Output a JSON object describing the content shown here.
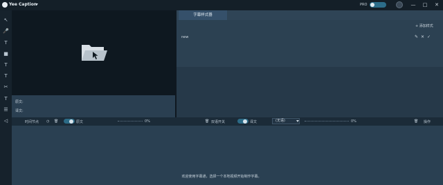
{
  "titlebar": {
    "app_title": "Yee Caption",
    "pro_label": "PRO",
    "minimize": "—",
    "maximize": "□",
    "close": "✕"
  },
  "tools": [
    "↖",
    "🎤",
    "T",
    "■",
    "T",
    "T",
    "✂",
    "T",
    "☰",
    "◁"
  ],
  "subtitles": {
    "line1_label": "原文:",
    "line2_label": "译文:"
  },
  "right_panel": {
    "tab_label": "字幕样式器",
    "add_style": "+ 添加样式",
    "style_name": "new",
    "edit_icon": "✎",
    "delete_icon": "✕",
    "confirm_icon": "✓"
  },
  "controls": {
    "timing_label": "时间节点",
    "source_label": "原文",
    "source_percent": "0%",
    "bilingual_label": "双语开关",
    "target_label": "译文",
    "lang_select": "(无语)",
    "target_percent": "0%",
    "action_label": "操作"
  },
  "welcome_text": "欢迎使用字幕通，选择一个本地视频开始制作字幕。",
  "colors": {
    "accent": "#2b6a86",
    "panel": "#2a4052",
    "preview": "#0e1820"
  }
}
